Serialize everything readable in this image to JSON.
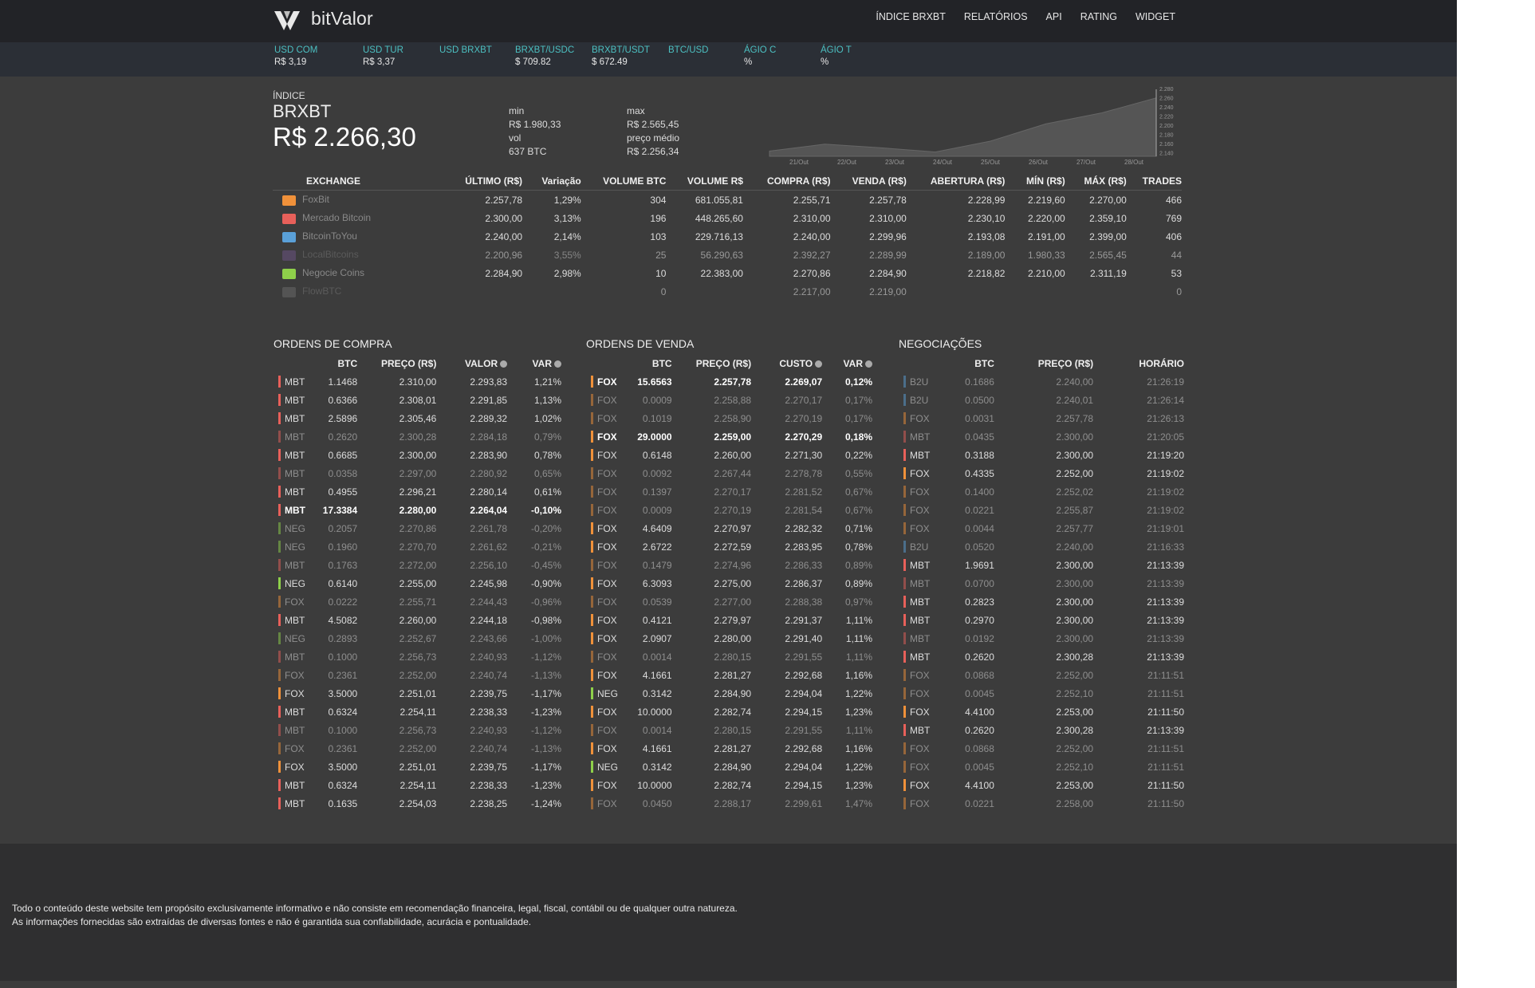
{
  "header": {
    "brand": "bitValor",
    "nav": [
      "ÍNDICE BRXBT",
      "RELATÓRIOS",
      "API",
      "RATING",
      "WIDGET"
    ]
  },
  "tickers": [
    {
      "label": "USD COM",
      "value": "R$ 3,19"
    },
    {
      "label": "USD TUR",
      "value": "R$ 3,37"
    },
    {
      "label": "USD BRXBT",
      "value": ""
    },
    {
      "label": "BRXBT/USDC",
      "value": "$ 709.82"
    },
    {
      "label": "BRXBT/USDT",
      "value": "$ 672.49"
    },
    {
      "label": "BTC/USD",
      "value": ""
    },
    {
      "label": "ÁGIO C",
      "value": "%"
    },
    {
      "label": "ÁGIO T",
      "value": "%"
    }
  ],
  "index": {
    "label": "ÍNDICE",
    "name": "BRXBT",
    "price": "R$ 2.266,30",
    "min_label": "min",
    "min": "R$ 1.980,33",
    "vol_label": "vol",
    "vol": "637 BTC",
    "max_label": "max",
    "max": "R$ 2.565,45",
    "avg_label": "preço médio",
    "avg": "R$ 2.256,34"
  },
  "chart_data": {
    "type": "area",
    "x": [
      "21/Out",
      "22/Out",
      "23/Out",
      "24/Out",
      "25/Out",
      "26/Out",
      "27/Out",
      "28/Out"
    ],
    "values": [
      2142,
      2158,
      2150,
      2140,
      2165,
      2205,
      2230,
      2265
    ],
    "yticks": [
      "2.280",
      "2.260",
      "2.240",
      "2.220",
      "2.200",
      "2.180",
      "2.160",
      "2.140"
    ],
    "ylim": [
      2130,
      2285
    ]
  },
  "exchanges": {
    "headers": [
      "EXCHANGE",
      "ÚLTIMO (R$)",
      "Variação",
      "VOLUME BTC",
      "VOLUME R$",
      "COMPRA (R$)",
      "VENDA (R$)",
      "ABERTURA (R$)",
      "MÍN (R$)",
      "MÁX (R$)",
      "TRADES"
    ],
    "rows": [
      {
        "color": "#f0913a",
        "name": "FoxBit",
        "last": "2.257,78",
        "var": "1,29%",
        "volbtc": "304",
        "volbrl": "681.055,81",
        "buy": "2.255,71",
        "sell": "2.257,78",
        "open": "2.228,99",
        "min": "2.219,60",
        "max": "2.270,00",
        "trades": "466"
      },
      {
        "color": "#e8605a",
        "name": "Mercado Bitcoin",
        "last": "2.300,00",
        "var": "3,13%",
        "volbtc": "196",
        "volbrl": "448.265,60",
        "buy": "2.310,00",
        "sell": "2.310,00",
        "open": "2.230,10",
        "min": "2.220,00",
        "max": "2.359,10",
        "trades": "769"
      },
      {
        "color": "#5aa0d8",
        "name": "BitcoinToYou",
        "last": "2.240,00",
        "var": "2,14%",
        "volbtc": "103",
        "volbrl": "229.716,13",
        "buy": "2.240,00",
        "sell": "2.299,96",
        "open": "2.193,08",
        "min": "2.191,00",
        "max": "2.399,00",
        "trades": "406"
      },
      {
        "color": "#7a5a9a",
        "name": "LocalBitcoins",
        "last": "2.200,96",
        "var": "3,55%",
        "volbtc": "25",
        "volbrl": "56.290,63",
        "buy": "2.392,27",
        "sell": "2.289,99",
        "open": "2.189,00",
        "min": "1.980,33",
        "max": "2.565,45",
        "trades": "44",
        "dim": true
      },
      {
        "color": "#8ed04a",
        "name": "Negocie Coins",
        "last": "2.284,90",
        "var": "2,98%",
        "volbtc": "10",
        "volbrl": "22.383,00",
        "buy": "2.270,86",
        "sell": "2.284,90",
        "open": "2.218,82",
        "min": "2.210,00",
        "max": "2.311,19",
        "trades": "53"
      },
      {
        "color": "#777777",
        "name": "FlowBTC",
        "last": "",
        "var": "",
        "volbtc": "0",
        "volbrl": "",
        "buy": "2.217,00",
        "sell": "2.219,00",
        "open": "",
        "min": "",
        "max": "",
        "trades": "0",
        "dim": true
      }
    ]
  },
  "buy_orders": {
    "title": "ORDENS DE COMPRA",
    "headers": [
      "",
      "BTC",
      "PREÇO (R$)",
      "VALOR",
      "VAR"
    ],
    "rows": [
      [
        "MBT",
        "1.1468",
        "2.310,00",
        "2.293,83",
        "1,21%"
      ],
      [
        "MBT",
        "0.6366",
        "2.308,01",
        "2.291,85",
        "1,13%"
      ],
      [
        "MBT",
        "2.5896",
        "2.305,46",
        "2.289,32",
        "1,02%"
      ],
      [
        "MBT",
        "0.2620",
        "2.300,28",
        "2.284,18",
        "0,79%"
      ],
      [
        "MBT",
        "0.6685",
        "2.300,00",
        "2.283,90",
        "0,78%"
      ],
      [
        "MBT",
        "0.0358",
        "2.297,00",
        "2.280,92",
        "0,65%"
      ],
      [
        "MBT",
        "0.4955",
        "2.296,21",
        "2.280,14",
        "0,61%"
      ],
      [
        "MBT",
        "17.3384",
        "2.280,00",
        "2.264,04",
        "-0,10%"
      ],
      [
        "NEG",
        "0.2057",
        "2.270,86",
        "2.261,78",
        "-0,20%"
      ],
      [
        "NEG",
        "0.1960",
        "2.270,70",
        "2.261,62",
        "-0,21%"
      ],
      [
        "MBT",
        "0.1763",
        "2.272,00",
        "2.256,10",
        "-0,45%"
      ],
      [
        "NEG",
        "0.6140",
        "2.255,00",
        "2.245,98",
        "-0,90%"
      ],
      [
        "FOX",
        "0.0222",
        "2.255,71",
        "2.244,43",
        "-0,96%"
      ],
      [
        "MBT",
        "4.5082",
        "2.260,00",
        "2.244,18",
        "-0,98%"
      ],
      [
        "NEG",
        "0.2893",
        "2.252,67",
        "2.243,66",
        "-1,00%"
      ],
      [
        "MBT",
        "0.1000",
        "2.256,73",
        "2.240,93",
        "-1,12%"
      ],
      [
        "FOX",
        "0.2361",
        "2.252,00",
        "2.240,74",
        "-1,13%"
      ],
      [
        "FOX",
        "3.5000",
        "2.251,01",
        "2.239,75",
        "-1,17%"
      ],
      [
        "MBT",
        "0.6324",
        "2.254,11",
        "2.238,33",
        "-1,23%"
      ],
      [
        "MBT",
        "0.1000",
        "2.256,73",
        "2.240,93",
        "-1,12%"
      ],
      [
        "FOX",
        "0.2361",
        "2.252,00",
        "2.240,74",
        "-1,13%"
      ],
      [
        "FOX",
        "3.5000",
        "2.251,01",
        "2.239,75",
        "-1,17%"
      ],
      [
        "MBT",
        "0.6324",
        "2.254,11",
        "2.238,33",
        "-1,23%"
      ],
      [
        "MBT",
        "0.1635",
        "2.254,03",
        "2.238,25",
        "-1,24%"
      ]
    ],
    "styles": [
      "",
      "",
      "",
      "d",
      "",
      "d",
      "",
      "b",
      "d",
      "d",
      "d",
      "",
      "d",
      "",
      "d",
      "d",
      "d",
      "",
      "",
      "d",
      "d",
      "",
      "",
      ""
    ]
  },
  "sell_orders": {
    "title": "ORDENS DE VENDA",
    "headers": [
      "",
      "BTC",
      "PREÇO (R$)",
      "CUSTO",
      "VAR"
    ],
    "rows": [
      [
        "FOX",
        "15.6563",
        "2.257,78",
        "2.269,07",
        "0,12%"
      ],
      [
        "FOX",
        "0.0009",
        "2.258,88",
        "2.270,17",
        "0,17%"
      ],
      [
        "FOX",
        "0.1019",
        "2.258,90",
        "2.270,19",
        "0,17%"
      ],
      [
        "FOX",
        "29.0000",
        "2.259,00",
        "2.270,29",
        "0,18%"
      ],
      [
        "FOX",
        "0.6148",
        "2.260,00",
        "2.271,30",
        "0,22%"
      ],
      [
        "FOX",
        "0.0092",
        "2.267,44",
        "2.278,78",
        "0,55%"
      ],
      [
        "FOX",
        "0.1397",
        "2.270,17",
        "2.281,52",
        "0,67%"
      ],
      [
        "FOX",
        "0.0009",
        "2.270,19",
        "2.281,54",
        "0,67%"
      ],
      [
        "FOX",
        "4.6409",
        "2.270,97",
        "2.282,32",
        "0,71%"
      ],
      [
        "FOX",
        "2.6722",
        "2.272,59",
        "2.283,95",
        "0,78%"
      ],
      [
        "FOX",
        "0.1479",
        "2.274,96",
        "2.286,33",
        "0,89%"
      ],
      [
        "FOX",
        "6.3093",
        "2.275,00",
        "2.286,37",
        "0,89%"
      ],
      [
        "FOX",
        "0.0539",
        "2.277,00",
        "2.288,38",
        "0,97%"
      ],
      [
        "FOX",
        "0.4121",
        "2.279,97",
        "2.291,37",
        "1,11%"
      ],
      [
        "FOX",
        "2.0907",
        "2.280,00",
        "2.291,40",
        "1,11%"
      ],
      [
        "FOX",
        "0.0014",
        "2.280,15",
        "2.291,55",
        "1,11%"
      ],
      [
        "FOX",
        "4.1661",
        "2.281,27",
        "2.292,68",
        "1,16%"
      ],
      [
        "NEG",
        "0.3142",
        "2.284,90",
        "2.294,04",
        "1,22%"
      ],
      [
        "FOX",
        "10.0000",
        "2.282,74",
        "2.294,15",
        "1,23%"
      ],
      [
        "FOX",
        "0.0014",
        "2.280,15",
        "2.291,55",
        "1,11%"
      ],
      [
        "FOX",
        "4.1661",
        "2.281,27",
        "2.292,68",
        "1,16%"
      ],
      [
        "NEG",
        "0.3142",
        "2.284,90",
        "2.294,04",
        "1,22%"
      ],
      [
        "FOX",
        "10.0000",
        "2.282,74",
        "2.294,15",
        "1,23%"
      ],
      [
        "FOX",
        "0.0450",
        "2.288,17",
        "2.299,61",
        "1,47%"
      ]
    ],
    "styles": [
      "b",
      "d",
      "d",
      "b",
      "",
      "d",
      "d",
      "d",
      "",
      "",
      "d",
      "",
      "d",
      "",
      "",
      "d",
      "",
      "",
      "",
      "d",
      "",
      "",
      "",
      "d"
    ]
  },
  "trades": {
    "title": "NEGOCIAÇÕES",
    "headers": [
      "",
      "BTC",
      "PREÇO (R$)",
      "HORÁRIO"
    ],
    "rows": [
      [
        "B2U",
        "0.1686",
        "2.240,00",
        "21:26:19"
      ],
      [
        "B2U",
        "0.0500",
        "2.240,01",
        "21:26:14"
      ],
      [
        "FOX",
        "0.0031",
        "2.257,78",
        "21:26:13"
      ],
      [
        "MBT",
        "0.0435",
        "2.300,00",
        "21:20:05"
      ],
      [
        "MBT",
        "0.3188",
        "2.300,00",
        "21:19:20"
      ],
      [
        "FOX",
        "0.4335",
        "2.252,00",
        "21:19:02"
      ],
      [
        "FOX",
        "0.1400",
        "2.252,02",
        "21:19:02"
      ],
      [
        "FOX",
        "0.0221",
        "2.255,87",
        "21:19:02"
      ],
      [
        "FOX",
        "0.0044",
        "2.257,77",
        "21:19:01"
      ],
      [
        "B2U",
        "0.0520",
        "2.240,00",
        "21:16:33"
      ],
      [
        "MBT",
        "1.9691",
        "2.300,00",
        "21:13:39"
      ],
      [
        "MBT",
        "0.0700",
        "2.300,00",
        "21:13:39"
      ],
      [
        "MBT",
        "0.2823",
        "2.300,00",
        "21:13:39"
      ],
      [
        "MBT",
        "0.2970",
        "2.300,00",
        "21:13:39"
      ],
      [
        "MBT",
        "0.0192",
        "2.300,00",
        "21:13:39"
      ],
      [
        "MBT",
        "0.2620",
        "2.300,28",
        "21:13:39"
      ],
      [
        "FOX",
        "0.0868",
        "2.252,00",
        "21:11:51"
      ],
      [
        "FOX",
        "0.0045",
        "2.252,10",
        "21:11:51"
      ],
      [
        "FOX",
        "4.4100",
        "2.253,00",
        "21:11:50"
      ],
      [
        "MBT",
        "0.2620",
        "2.300,28",
        "21:13:39"
      ],
      [
        "FOX",
        "0.0868",
        "2.252,00",
        "21:11:51"
      ],
      [
        "FOX",
        "0.0045",
        "2.252,10",
        "21:11:51"
      ],
      [
        "FOX",
        "4.4100",
        "2.253,00",
        "21:11:50"
      ],
      [
        "FOX",
        "0.0221",
        "2.258,00",
        "21:11:50"
      ]
    ],
    "styles": [
      "d",
      "d",
      "d",
      "d",
      "",
      "",
      "d",
      "d",
      "d",
      "d",
      "",
      "d",
      "",
      "",
      "d",
      "",
      "d",
      "d",
      "",
      "",
      "d",
      "d",
      "",
      "d"
    ]
  },
  "exchange_colors": {
    "MBT": "#e8605a",
    "NEG": "#8ed04a",
    "FOX": "#f0913a",
    "B2U": "#5aa0d8"
  },
  "footer": {
    "line1": "Todo o conteúdo deste website tem propósito exclusivamente informativo e não consiste em recomendação financeira, legal, fiscal, contábil ou de qualquer outra natureza.",
    "line2": "As informações fornecidas são extraídas de diversas fontes e não é garantida sua confiabilidade, acurácia e pontualidade."
  }
}
